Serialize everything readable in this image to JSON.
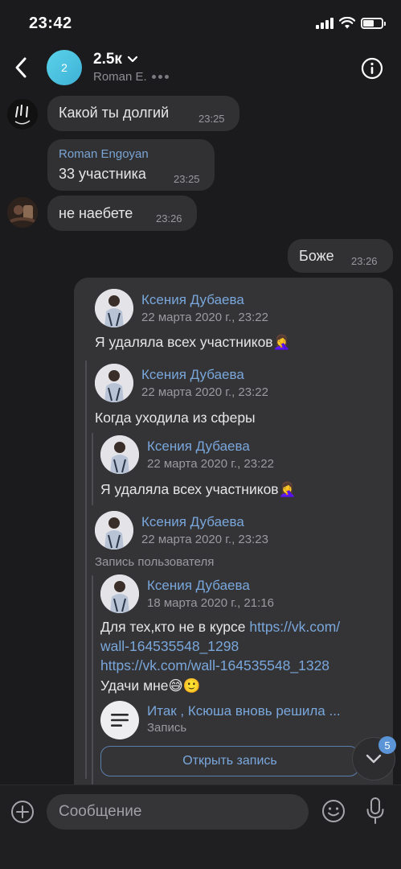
{
  "status_bar": {
    "time": "23:42"
  },
  "header": {
    "avatar_text": "2",
    "title": "2.5к",
    "subtitle": "Roman E."
  },
  "messages": [
    {
      "text": "Какой ты долгий",
      "time": "23:25"
    },
    {
      "sender": "Roman Engoyan",
      "text": "33 участника",
      "time": "23:25"
    },
    {
      "text": "не наебете",
      "time": "23:26"
    },
    {
      "text": "Боже",
      "time": "23:26"
    }
  ],
  "forwarded": {
    "level1": {
      "name": "Ксения Дубаева",
      "date": "22 марта 2020 г., 23:22",
      "text": "Я удаляла всех участников",
      "emoji": "🤦‍♀️"
    },
    "level2": {
      "name": "Ксения Дубаева",
      "date": "22 марта 2020 г., 23:22",
      "text": "Когда уходила из сферы"
    },
    "level3": {
      "name": "Ксения Дубаева",
      "date": "22 марта 2020 г., 23:22",
      "text": "Я удаляла всех участников",
      "emoji": "🤦‍♀️"
    },
    "level2b": {
      "name": "Ксения Дубаева",
      "date": "22 марта 2020 г., 23:23",
      "post_label": "Запись пользователя"
    },
    "post": {
      "name": "Ксения Дубаева",
      "date": "18 марта 2020 г., 21:16",
      "text_prefix": "Для тех,кто не в курсе ",
      "link1_part1": "https://vk.com/",
      "link1_part2": "wall-164535548_1298",
      "link2": "https://vk.com/wall-164535548_1328",
      "closing": "Удачи мне",
      "closing_emoji": "😅🙂",
      "attachment_title": "Итак , Ксюша вновь решила ...",
      "attachment_sub": "Запись",
      "open_button": "Открыть запись"
    }
  },
  "scroll_badge": "5",
  "composer": {
    "placeholder": "Сообщение"
  },
  "colors": {
    "accent": "#79a7dc",
    "bubble": "#313133",
    "background": "#1b1b1d"
  }
}
